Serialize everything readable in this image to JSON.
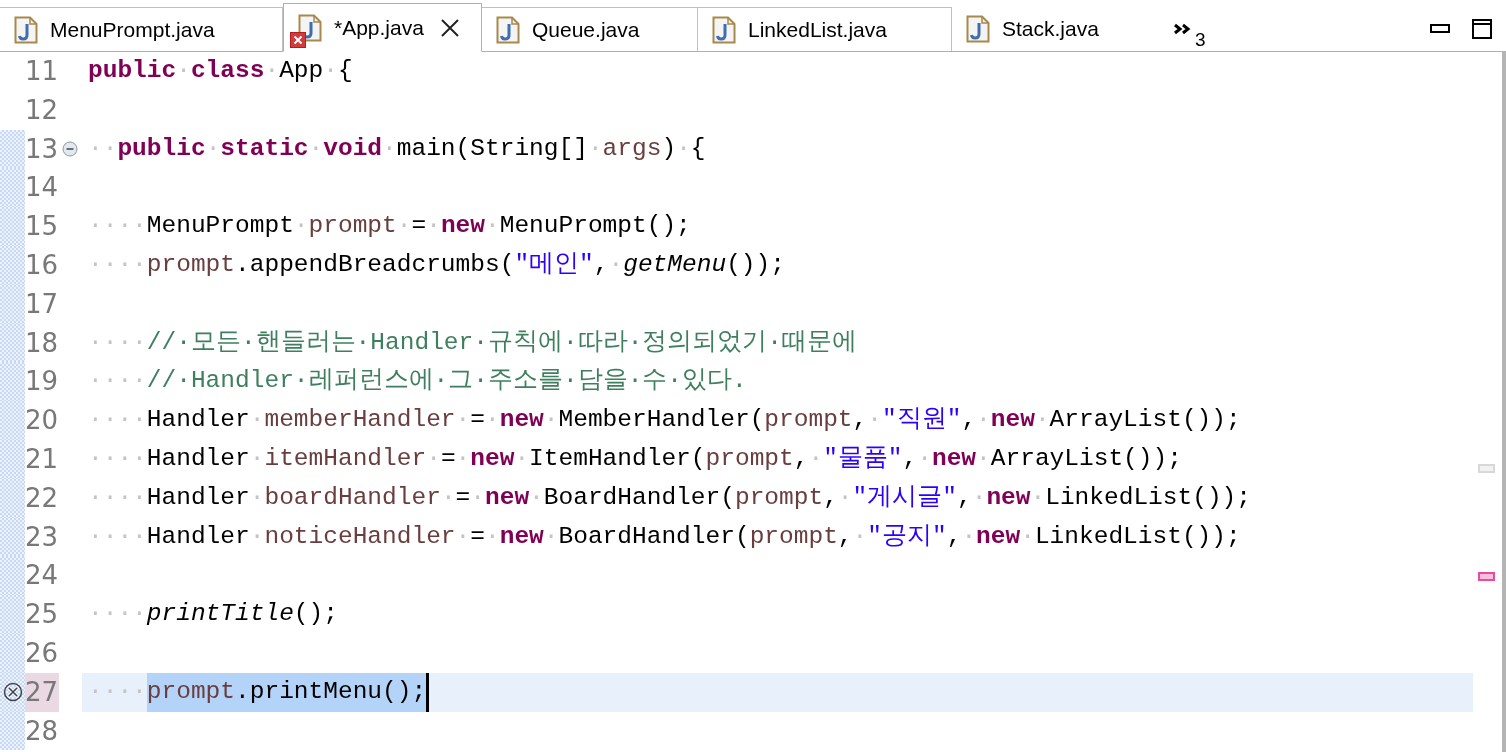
{
  "tabs": [
    {
      "label": "MenuPrompt.java",
      "selected": false,
      "error": false
    },
    {
      "label": "*App.java",
      "selected": true,
      "error": true
    },
    {
      "label": "Queue.java",
      "selected": false,
      "error": false
    },
    {
      "label": "LinkedList.java",
      "selected": false,
      "error": false
    },
    {
      "label": "Stack.java",
      "selected": false,
      "error": false
    }
  ],
  "overflow": {
    "count": "3"
  },
  "editor": {
    "lines": [
      {
        "number": "11",
        "changed": false,
        "fold": false,
        "error": false,
        "current": false,
        "tokens": [
          {
            "kind": "keyword",
            "text": "public"
          },
          {
            "kind": "ws",
            "text": "·"
          },
          {
            "kind": "keyword",
            "text": "class"
          },
          {
            "kind": "ws",
            "text": "·"
          },
          {
            "kind": "plain",
            "text": "App"
          },
          {
            "kind": "ws",
            "text": "·"
          },
          {
            "kind": "plain",
            "text": "{"
          }
        ]
      },
      {
        "number": "12",
        "changed": false,
        "fold": false,
        "error": false,
        "current": false
      },
      {
        "number": "13",
        "changed": true,
        "fold": true,
        "error": false,
        "current": false,
        "tokens": [
          {
            "kind": "ws",
            "text": "··"
          },
          {
            "kind": "keyword",
            "text": "public"
          },
          {
            "kind": "ws",
            "text": "·"
          },
          {
            "kind": "keyword",
            "text": "static"
          },
          {
            "kind": "ws",
            "text": "·"
          },
          {
            "kind": "keyword",
            "text": "void"
          },
          {
            "kind": "ws",
            "text": "·"
          },
          {
            "kind": "plain",
            "text": "main(String[]"
          },
          {
            "kind": "ws",
            "text": "·"
          },
          {
            "kind": "var",
            "text": "args"
          },
          {
            "kind": "plain",
            "text": ")"
          },
          {
            "kind": "ws",
            "text": "·"
          },
          {
            "kind": "plain",
            "text": "{"
          }
        ]
      },
      {
        "number": "14",
        "changed": true,
        "fold": false,
        "error": false,
        "current": false
      },
      {
        "number": "15",
        "changed": true,
        "fold": false,
        "error": false,
        "current": false,
        "tokens": [
          {
            "kind": "ws",
            "text": "····"
          },
          {
            "kind": "plain",
            "text": "MenuPrompt"
          },
          {
            "kind": "ws",
            "text": "·"
          },
          {
            "kind": "var",
            "text": "prompt"
          },
          {
            "kind": "ws",
            "text": "·"
          },
          {
            "kind": "plain",
            "text": "="
          },
          {
            "kind": "ws",
            "text": "·"
          },
          {
            "kind": "keyword",
            "text": "new"
          },
          {
            "kind": "ws",
            "text": "·"
          },
          {
            "kind": "plain",
            "text": "MenuPrompt();"
          }
        ]
      },
      {
        "number": "16",
        "changed": true,
        "fold": false,
        "error": false,
        "current": false,
        "tokens": [
          {
            "kind": "ws",
            "text": "····"
          },
          {
            "kind": "var",
            "text": "prompt"
          },
          {
            "kind": "plain",
            "text": ".appendBreadcrumbs("
          },
          {
            "kind": "string",
            "text": "\"메인\""
          },
          {
            "kind": "plain",
            "text": ","
          },
          {
            "kind": "ws",
            "text": "·"
          },
          {
            "kind": "static",
            "text": "getMenu"
          },
          {
            "kind": "plain",
            "text": "());"
          }
        ]
      },
      {
        "number": "17",
        "changed": true,
        "fold": false,
        "error": false,
        "current": false
      },
      {
        "number": "18",
        "changed": true,
        "fold": false,
        "error": false,
        "current": false,
        "tokens": [
          {
            "kind": "ws",
            "text": "····"
          },
          {
            "kind": "comment",
            "text": "//·모든·핸들러는·Handler·규칙에·따라·정의되었기·때문에"
          }
        ]
      },
      {
        "number": "19",
        "changed": true,
        "fold": false,
        "error": false,
        "current": false,
        "tokens": [
          {
            "kind": "ws",
            "text": "····"
          },
          {
            "kind": "comment",
            "text": "//·Handler·레퍼런스에·그·주소를·담을·수·있다."
          }
        ]
      },
      {
        "number": "20",
        "changed": true,
        "fold": false,
        "error": false,
        "current": false,
        "tokens": [
          {
            "kind": "ws",
            "text": "····"
          },
          {
            "kind": "plain",
            "text": "Handler"
          },
          {
            "kind": "ws",
            "text": "·"
          },
          {
            "kind": "var",
            "text": "memberHandler"
          },
          {
            "kind": "ws",
            "text": "·"
          },
          {
            "kind": "plain",
            "text": "="
          },
          {
            "kind": "ws",
            "text": "·"
          },
          {
            "kind": "keyword",
            "text": "new"
          },
          {
            "kind": "ws",
            "text": "·"
          },
          {
            "kind": "plain",
            "text": "MemberHandler("
          },
          {
            "kind": "var",
            "text": "prompt"
          },
          {
            "kind": "plain",
            "text": ","
          },
          {
            "kind": "ws",
            "text": "·"
          },
          {
            "kind": "string",
            "text": "\"직원\""
          },
          {
            "kind": "plain",
            "text": ","
          },
          {
            "kind": "ws",
            "text": "·"
          },
          {
            "kind": "keyword",
            "text": "new"
          },
          {
            "kind": "ws",
            "text": "·"
          },
          {
            "kind": "plain",
            "text": "ArrayList());"
          }
        ]
      },
      {
        "number": "21",
        "changed": true,
        "fold": false,
        "error": false,
        "current": false,
        "tokens": [
          {
            "kind": "ws",
            "text": "····"
          },
          {
            "kind": "plain",
            "text": "Handler"
          },
          {
            "kind": "ws",
            "text": "·"
          },
          {
            "kind": "var",
            "text": "itemHandler"
          },
          {
            "kind": "ws",
            "text": "·"
          },
          {
            "kind": "plain",
            "text": "="
          },
          {
            "kind": "ws",
            "text": "·"
          },
          {
            "kind": "keyword",
            "text": "new"
          },
          {
            "kind": "ws",
            "text": "·"
          },
          {
            "kind": "plain",
            "text": "ItemHandler("
          },
          {
            "kind": "var",
            "text": "prompt"
          },
          {
            "kind": "plain",
            "text": ","
          },
          {
            "kind": "ws",
            "text": "·"
          },
          {
            "kind": "string",
            "text": "\"물품\""
          },
          {
            "kind": "plain",
            "text": ","
          },
          {
            "kind": "ws",
            "text": "·"
          },
          {
            "kind": "keyword",
            "text": "new"
          },
          {
            "kind": "ws",
            "text": "·"
          },
          {
            "kind": "plain",
            "text": "ArrayList());"
          }
        ]
      },
      {
        "number": "22",
        "changed": true,
        "fold": false,
        "error": false,
        "current": false,
        "tokens": [
          {
            "kind": "ws",
            "text": "····"
          },
          {
            "kind": "plain",
            "text": "Handler"
          },
          {
            "kind": "ws",
            "text": "·"
          },
          {
            "kind": "var",
            "text": "boardHandler"
          },
          {
            "kind": "ws",
            "text": "·"
          },
          {
            "kind": "plain",
            "text": "="
          },
          {
            "kind": "ws",
            "text": "·"
          },
          {
            "kind": "keyword",
            "text": "new"
          },
          {
            "kind": "ws",
            "text": "·"
          },
          {
            "kind": "plain",
            "text": "BoardHandler("
          },
          {
            "kind": "var",
            "text": "prompt"
          },
          {
            "kind": "plain",
            "text": ","
          },
          {
            "kind": "ws",
            "text": "·"
          },
          {
            "kind": "string",
            "text": "\"게시글\""
          },
          {
            "kind": "plain",
            "text": ","
          },
          {
            "kind": "ws",
            "text": "·"
          },
          {
            "kind": "keyword",
            "text": "new"
          },
          {
            "kind": "ws",
            "text": "·"
          },
          {
            "kind": "plain",
            "text": "LinkedList());"
          }
        ]
      },
      {
        "number": "23",
        "changed": true,
        "fold": false,
        "error": false,
        "current": false,
        "tokens": [
          {
            "kind": "ws",
            "text": "····"
          },
          {
            "kind": "plain",
            "text": "Handler"
          },
          {
            "kind": "ws",
            "text": "·"
          },
          {
            "kind": "var",
            "text": "noticeHandler"
          },
          {
            "kind": "ws",
            "text": "·"
          },
          {
            "kind": "plain",
            "text": "="
          },
          {
            "kind": "ws",
            "text": "·"
          },
          {
            "kind": "keyword",
            "text": "new"
          },
          {
            "kind": "ws",
            "text": "·"
          },
          {
            "kind": "plain",
            "text": "BoardHandler("
          },
          {
            "kind": "var",
            "text": "prompt"
          },
          {
            "kind": "plain",
            "text": ","
          },
          {
            "kind": "ws",
            "text": "·"
          },
          {
            "kind": "string",
            "text": "\"공지\""
          },
          {
            "kind": "plain",
            "text": ","
          },
          {
            "kind": "ws",
            "text": "·"
          },
          {
            "kind": "keyword",
            "text": "new"
          },
          {
            "kind": "ws",
            "text": "·"
          },
          {
            "kind": "plain",
            "text": "LinkedList());"
          }
        ]
      },
      {
        "number": "24",
        "changed": true,
        "fold": false,
        "error": false,
        "current": false
      },
      {
        "number": "25",
        "changed": true,
        "fold": false,
        "error": false,
        "current": false,
        "tokens": [
          {
            "kind": "ws",
            "text": "····"
          },
          {
            "kind": "static",
            "text": "printTitle"
          },
          {
            "kind": "plain",
            "text": "();"
          }
        ]
      },
      {
        "number": "26",
        "changed": true,
        "fold": false,
        "error": false,
        "current": false
      },
      {
        "number": "27",
        "changed": true,
        "fold": false,
        "error": true,
        "current": true,
        "tokens": [
          {
            "kind": "ws",
            "text": "····"
          }
        ],
        "selection": [
          {
            "kind": "var",
            "text": "prompt"
          },
          {
            "kind": "plain",
            "text": ".printMenu();"
          }
        ]
      },
      {
        "number": "28",
        "changed": true,
        "fold": false,
        "error": false,
        "current": false
      }
    ],
    "overview_markers": [
      {
        "color": "#d8d8d8"
      },
      {
        "color": "#e74b9a"
      }
    ]
  }
}
